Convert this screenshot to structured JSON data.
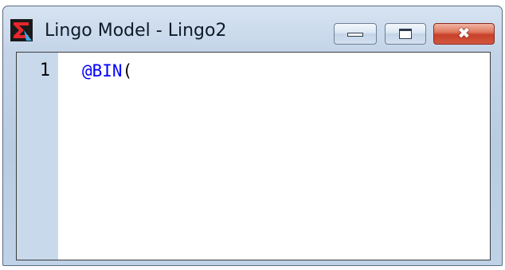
{
  "window": {
    "title": "Lingo Model - Lingo2"
  },
  "app_icon": "sigma-icon",
  "caption_buttons": {
    "minimize_icon": "minimize-icon",
    "maximize_icon": "maximize-icon",
    "close_icon": "close-icon",
    "close_glyph": "✖"
  },
  "editor": {
    "lines": [
      {
        "number": "1",
        "keyword": "@BIN",
        "rest": "("
      }
    ]
  },
  "colors": {
    "keyword": "#0000ff",
    "gutter": "#c9d9ec",
    "close_button": "#c8402a"
  }
}
